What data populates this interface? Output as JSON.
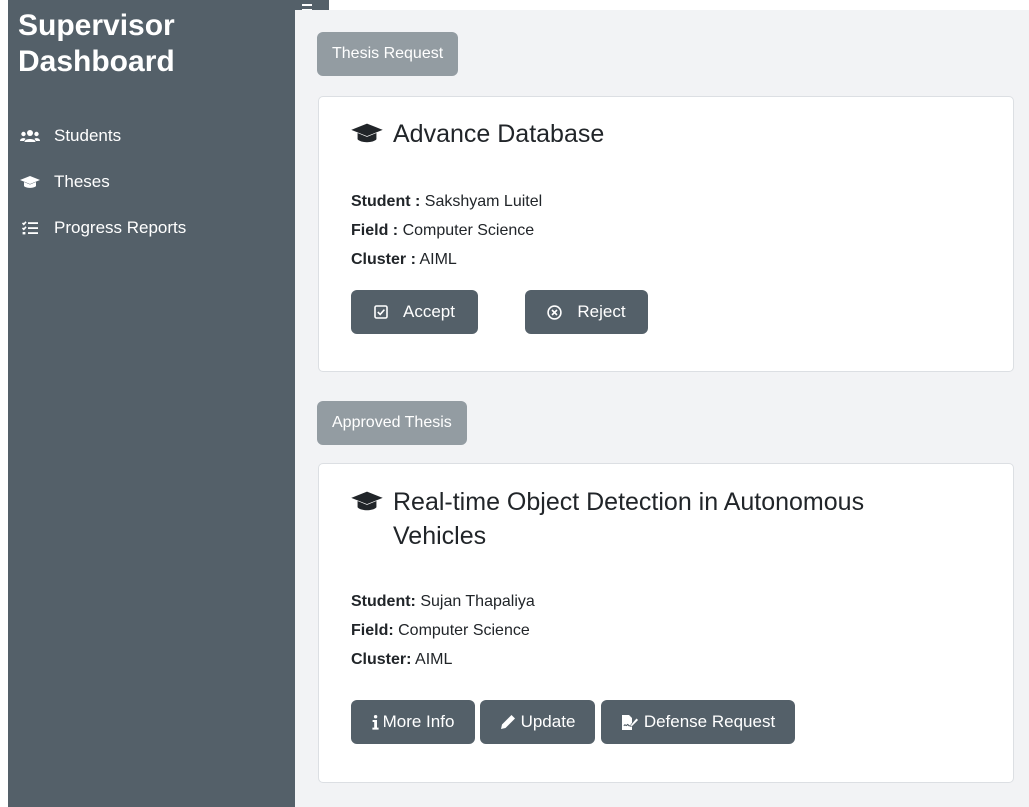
{
  "sidebar": {
    "title_line1": "Supervisor",
    "title_line2": "Dashboard",
    "items": [
      {
        "label": "Students",
        "icon": "users-icon"
      },
      {
        "label": "Theses",
        "icon": "graduation-cap-icon"
      },
      {
        "label": "Progress Reports",
        "icon": "list-check-icon"
      }
    ]
  },
  "sections": {
    "requests_label": "Thesis Request",
    "approved_label": "Approved Thesis"
  },
  "request_card": {
    "title": "Advance Database",
    "student_label": "Student :",
    "student": "Sakshyam Luitel",
    "field_label": "Field :",
    "field": "Computer Science",
    "cluster_label": "Cluster :",
    "cluster": "AIML",
    "accept_label": "Accept",
    "reject_label": "Reject"
  },
  "approved_card": {
    "title_line1": "Real-time Object Detection in Autonomous",
    "title_line2": "Vehicles",
    "student_label": "Student:",
    "student": "Sujan Thapaliya",
    "field_label": "Field:",
    "field": "Computer Science",
    "cluster_label": "Cluster:",
    "cluster": "AIML",
    "more_info_label": "More Info",
    "update_label": "Update",
    "defense_label": "Defense Request"
  },
  "colors": {
    "sidebar": "#546069",
    "badge": "#939ca2",
    "button": "#546069",
    "main_bg": "#f2f3f5"
  }
}
